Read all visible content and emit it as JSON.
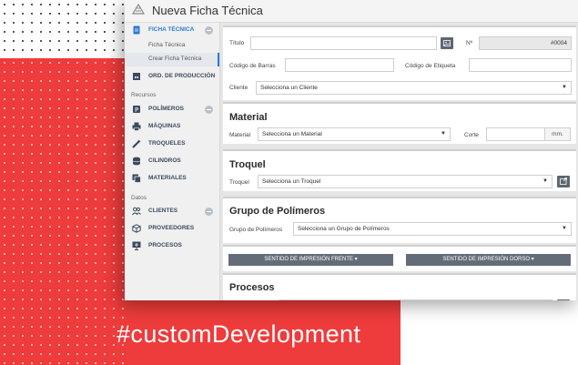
{
  "app": {
    "title": "Nueva Ficha Técnica"
  },
  "sidebar": {
    "ficha_tecnica": "FICHA TÉCNICA",
    "sub_items": [
      "Ficha Técnica",
      "Crear Ficha Técnica"
    ],
    "ord_produccion": "ORD. DE PRODUCCIÓN",
    "recursos_label": "Recursos",
    "recursos": [
      "POLÍMEROS",
      "MÁQUINAS",
      "TROQUELES",
      "CILINDROS",
      "MATERIALES"
    ],
    "datos_label": "Datos",
    "datos": [
      "CLIENTES",
      "PROVEEDORES",
      "PROCESOS"
    ]
  },
  "form": {
    "titulo_label": "Título",
    "numero_label": "Nº",
    "numero_value": "#0004",
    "codigo_barras_label": "Código de Barras",
    "codigo_etiqueta_label": "Código de Etiqueta",
    "cliente_label": "Cliente",
    "cliente_value": "Selecciona un Cliente"
  },
  "material": {
    "title": "Material",
    "material_label": "Material",
    "material_value": "Selecciona un Material",
    "corte_label": "Corte",
    "corte_unit": "mm."
  },
  "troquel": {
    "title": "Troquel",
    "label": "Troquel",
    "value": "Selecciona un Troquel"
  },
  "polimeros": {
    "title": "Grupo de Polímeros",
    "label": "Grupo de Polímeros",
    "value": "Selecciona un Grupo de Polímeros"
  },
  "sentido": {
    "frente": "SENTIDO DE IMPRESIÓN FRENTE",
    "dorso": "SENTIDO DE IMPRESIÓN DORSO"
  },
  "procesos": {
    "title": "Procesos"
  },
  "banner": {
    "hashtag": "#customDevelopment"
  },
  "colors": {
    "accent_red": "#ee3b3b",
    "nav_blue": "#2a7bd1",
    "button_gray": "#646d77"
  }
}
